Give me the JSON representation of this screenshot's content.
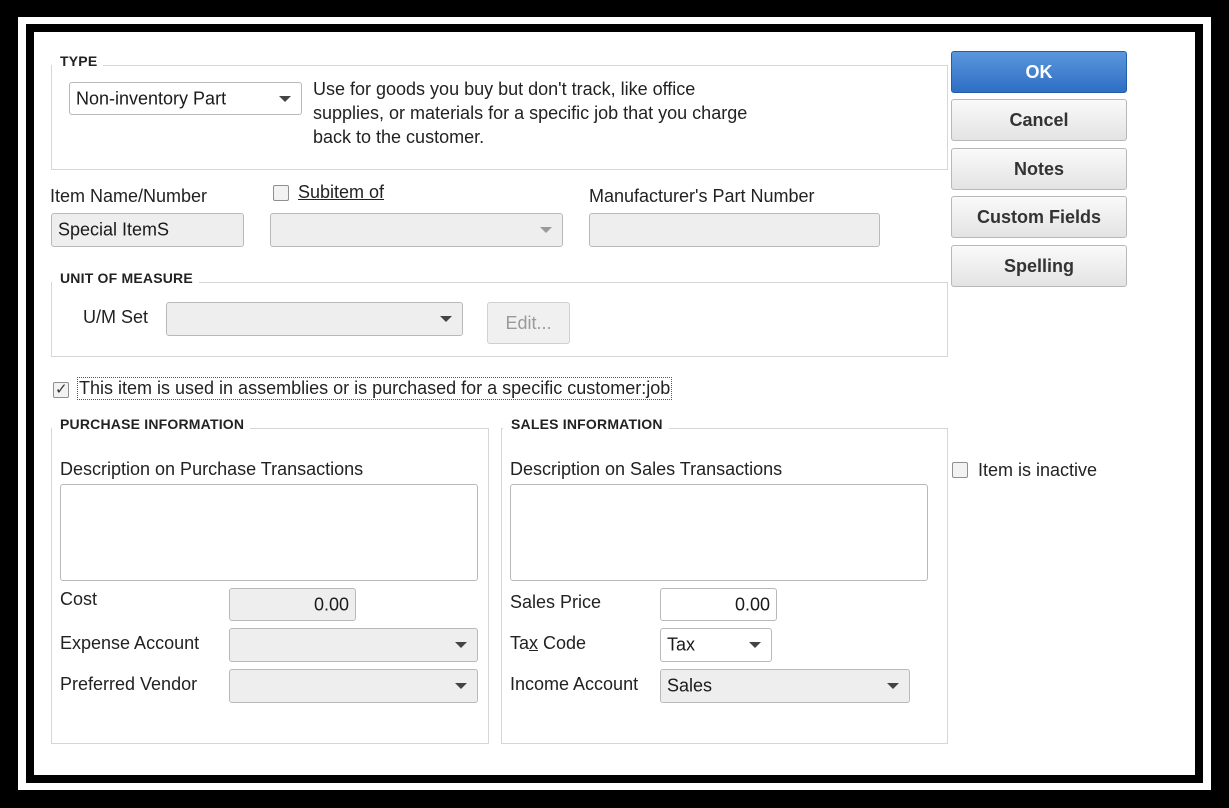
{
  "type_group": {
    "label": "TYPE",
    "selected_type": "Non-inventory Part",
    "description_lines": [
      "Use for goods you buy but don't track, like office",
      "supplies, or materials for a specific job that you charge",
      "back to the customer."
    ]
  },
  "item": {
    "name_label": "Item Name/Number",
    "name_value": "Special ItemS",
    "subitem_label": "Subitem of",
    "subitem_checked": false,
    "subitem_value": "",
    "mpn_label": "Manufacturer's Part Number",
    "mpn_value": ""
  },
  "uom_group": {
    "label": "UNIT OF MEASURE",
    "set_label": "U/M Set",
    "set_value": "",
    "edit_label": "Edit..."
  },
  "assembly_checkbox": {
    "label": "This item is used in assemblies or is purchased for a specific customer:job",
    "checked": true
  },
  "purchase": {
    "group_label": "PURCHASE INFORMATION",
    "desc_label": "Description on Purchase Transactions",
    "desc_value": "",
    "cost_label": "Cost",
    "cost_value": "0.00",
    "expense_label": "Expense Account",
    "expense_value": "",
    "vendor_label": "Preferred Vendor",
    "vendor_value": ""
  },
  "sales": {
    "group_label": "SALES INFORMATION",
    "desc_label": "Description on Sales Transactions",
    "desc_value": "",
    "price_label": "Sales Price",
    "price_value": "0.00",
    "tax_label": "Tax Code",
    "tax_value": "Tax",
    "income_label": "Income Account",
    "income_value": "Sales"
  },
  "buttons": {
    "ok": "OK",
    "cancel": "Cancel",
    "notes": "Notes",
    "custom_fields": "Custom Fields",
    "spelling": "Spelling"
  },
  "inactive": {
    "label": "Item is inactive",
    "checked": false
  },
  "colors": {
    "primary_button": "#3a7bd5",
    "frame": "#000000"
  }
}
